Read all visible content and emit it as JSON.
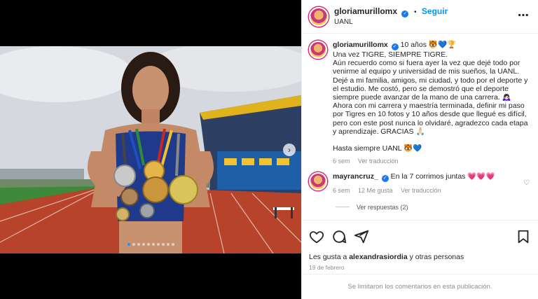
{
  "media": {
    "dots_total": 10,
    "active_dot": 0,
    "next_icon": "chevron-right-icon"
  },
  "header": {
    "username": "gloriamurillomx",
    "follow_label": "Seguir",
    "location": "UANL",
    "more_icon": "more-icon"
  },
  "caption": {
    "username": "gloriamurillomx",
    "title": "10 años 🐯💙🏆",
    "lines": [
      "Una vez TIGRE, SIEMPRE TIGRE.",
      "Aún recuerdo como si fuera ayer la vez que dejé todo por venirme al equipo y universidad de mis sueños, la UANL. Dejé a mi familia, amigos, mi ciudad, y todo por el deporte y el estudio. Me costó, pero se demostró que el deporte siempre puede avanzar de la mano de una carrera. 🙇🏻‍♀️",
      "Ahora con mi carrera y maestría terminada, definir mi paso por Tigres en 10 fotos y 10 años desde que llegué es difícil, pero con este post nunca lo olvidaré, agradezco cada etapa y aprendizaje. GRACIAS 🙏🏻"
    ],
    "signoff": "Hasta siempre UANL 🐯💙",
    "time": "6 sem",
    "translate": "Ver traducción"
  },
  "comment": {
    "username": "mayrancruz_",
    "text": "En la 7 corrimos juntas 💗💗💗",
    "time": "6 sem",
    "likes": "12 Me gusta",
    "translate": "Ver traducción",
    "view_replies": "Ver respuestas (2)"
  },
  "actions": {
    "likes_text_prefix": "Les gusta a ",
    "likes_user": "alexandrasiordia",
    "likes_text_suffix": " y otras personas",
    "date": "19 de febrero"
  },
  "footer": {
    "text": "Se limitaron los comentarios en esta publicación."
  },
  "colors": {
    "accent": "#0095f6",
    "verified": "#1877f2",
    "muted": "#8e8e8e"
  }
}
